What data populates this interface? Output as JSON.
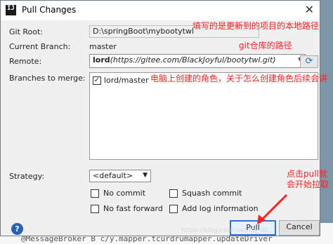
{
  "window": {
    "title": "Pull Changes",
    "icon_text": "IJ",
    "close": "✕"
  },
  "form": {
    "git_root_label": "Git Root:",
    "git_root_value": "D:\\springBoot\\mybootytwl",
    "current_branch_label": "Current Branch:",
    "current_branch_value": "master",
    "remote_label": "Remote:",
    "remote_name": "lord",
    "remote_url": "(https://gitee.com/BlackJoyful/bootytwl.git)",
    "branches_label": "Branches to merge:",
    "branches": [
      {
        "label": "lord/master",
        "checked": true
      }
    ],
    "strategy_label": "Strategy:",
    "strategy_value": "<default>",
    "options": [
      {
        "label": "No commit",
        "checked": false
      },
      {
        "label": "Squash commit",
        "checked": false
      },
      {
        "label": "No fast forward",
        "checked": false
      },
      {
        "label": "Add log information",
        "checked": false
      }
    ]
  },
  "buttons": {
    "help": "?",
    "pull": "Pull",
    "cancel": "Cancel"
  },
  "annotations": {
    "root_note": "填写的是更新到的项目的本地路径",
    "remote_note": "git仓库的路径",
    "branch_note": "电脑上创建的角色，关于怎么创建角色后续会讲",
    "pull_note": "点击pull就会开始拉取"
  },
  "background": {
    "editor_text": "@MessageBroker B  c/y.mapper.tcurdrumapper.updateDriver",
    "watermark": "https://blog.csdn.net/qq_40..."
  },
  "colors": {
    "annotation": "#ff2020",
    "focus_border": "#2f6fd6",
    "help_icon": "#2763b5"
  }
}
